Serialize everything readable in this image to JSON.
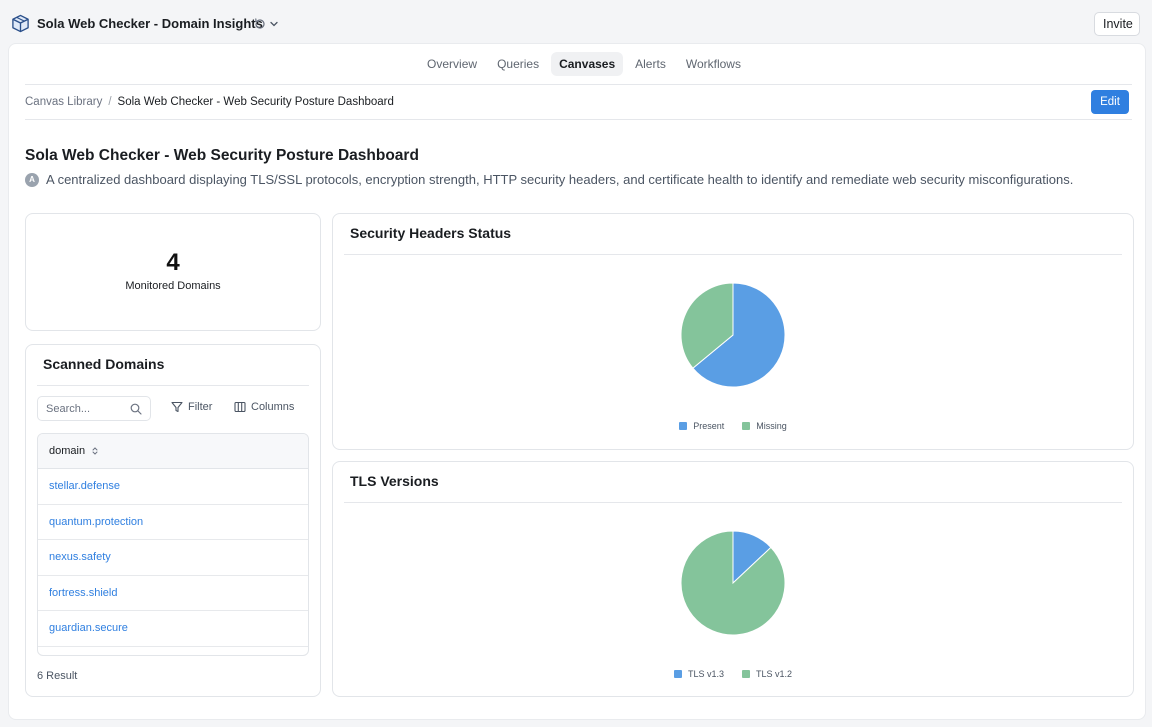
{
  "app": {
    "title": "Sola Web Checker - Domain Insights",
    "invite_label": "Invite"
  },
  "tabs": [
    {
      "label": "Overview",
      "active": false
    },
    {
      "label": "Queries",
      "active": false
    },
    {
      "label": "Canvases",
      "active": true
    },
    {
      "label": "Alerts",
      "active": false
    },
    {
      "label": "Workflows",
      "active": false
    }
  ],
  "breadcrumb": {
    "root": "Canvas Library",
    "separator": "/",
    "current": "Sola Web Checker - Web Security Posture Dashboard"
  },
  "edit_label": "Edit",
  "page": {
    "title": "Sola Web Checker - Web Security Posture Dashboard",
    "badge": "A",
    "description": "A centralized dashboard displaying TLS/SSL protocols, encryption strength, HTTP security headers, and certificate health to identify and remediate web security misconfigurations."
  },
  "kpi": {
    "value": "4",
    "label": "Monitored Domains"
  },
  "domains": {
    "title": "Scanned Domains",
    "search_placeholder": "Search...",
    "filter_label": "Filter",
    "columns_label": "Columns",
    "column_header": "domain",
    "rows": [
      "stellar.defense",
      "quantum.protection",
      "nexus.safety",
      "fortress.shield",
      "guardian.secure"
    ],
    "result_count": "6 Result"
  },
  "colors": {
    "blue": "#5a9ee4",
    "green": "#84c49b",
    "accent": "#2f7fe0"
  },
  "chart_data": [
    {
      "type": "pie",
      "title": "Security Headers Status",
      "labels": [
        "Present",
        "Missing"
      ],
      "values": [
        64,
        36
      ],
      "colors": [
        "#5a9ee4",
        "#84c49b"
      ],
      "legend": "bottom"
    },
    {
      "type": "pie",
      "title": "TLS Versions",
      "labels": [
        "TLS v1.3",
        "TLS v1.2"
      ],
      "values": [
        13,
        87
      ],
      "colors": [
        "#5a9ee4",
        "#84c49b"
      ],
      "legend": "bottom"
    }
  ]
}
